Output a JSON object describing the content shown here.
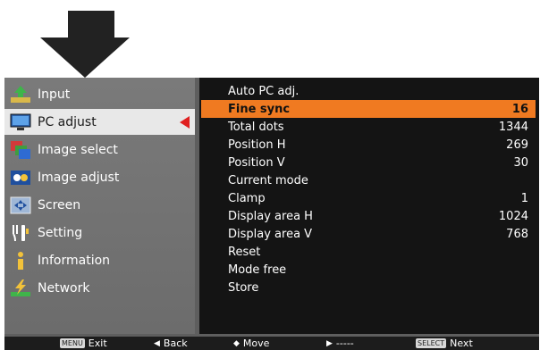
{
  "colors": {
    "highlight": "#f07a21",
    "pointer": "#e02020",
    "panel_bg": "#141414",
    "menu_bg": "#747474"
  },
  "menu": [
    {
      "label": "Input",
      "icon": "input-icon"
    },
    {
      "label": "PC adjust",
      "icon": "monitor-icon",
      "selected": true
    },
    {
      "label": "Image select",
      "icon": "image-select-icon"
    },
    {
      "label": "Image adjust",
      "icon": "image-adjust-icon"
    },
    {
      "label": "Screen",
      "icon": "screen-icon"
    },
    {
      "label": "Setting",
      "icon": "setting-icon"
    },
    {
      "label": "Information",
      "icon": "information-icon"
    },
    {
      "label": "Network",
      "icon": "network-icon"
    }
  ],
  "settings": [
    {
      "label": "Auto PC adj.",
      "value": ""
    },
    {
      "label": "Fine sync",
      "value": "16",
      "highlighted": true
    },
    {
      "label": "Total dots",
      "value": "1344"
    },
    {
      "label": "Position H",
      "value": "269"
    },
    {
      "label": "Position V",
      "value": "30"
    },
    {
      "label": "Current mode",
      "value": ""
    },
    {
      "label": "Clamp",
      "value": "1"
    },
    {
      "label": "Display area H",
      "value": "1024"
    },
    {
      "label": "Display area V",
      "value": "768"
    },
    {
      "label": "Reset",
      "value": ""
    },
    {
      "label": "Mode free",
      "value": ""
    },
    {
      "label": "Store",
      "value": ""
    }
  ],
  "footer": {
    "exit_key": "MENU",
    "exit": "Exit",
    "back_glyph": "◀",
    "back": "Back",
    "move_glyph": "◆",
    "move": "Move",
    "right_glyph": "▶",
    "right_dashes": "-----",
    "next_key": "SELECT",
    "next": "Next"
  }
}
